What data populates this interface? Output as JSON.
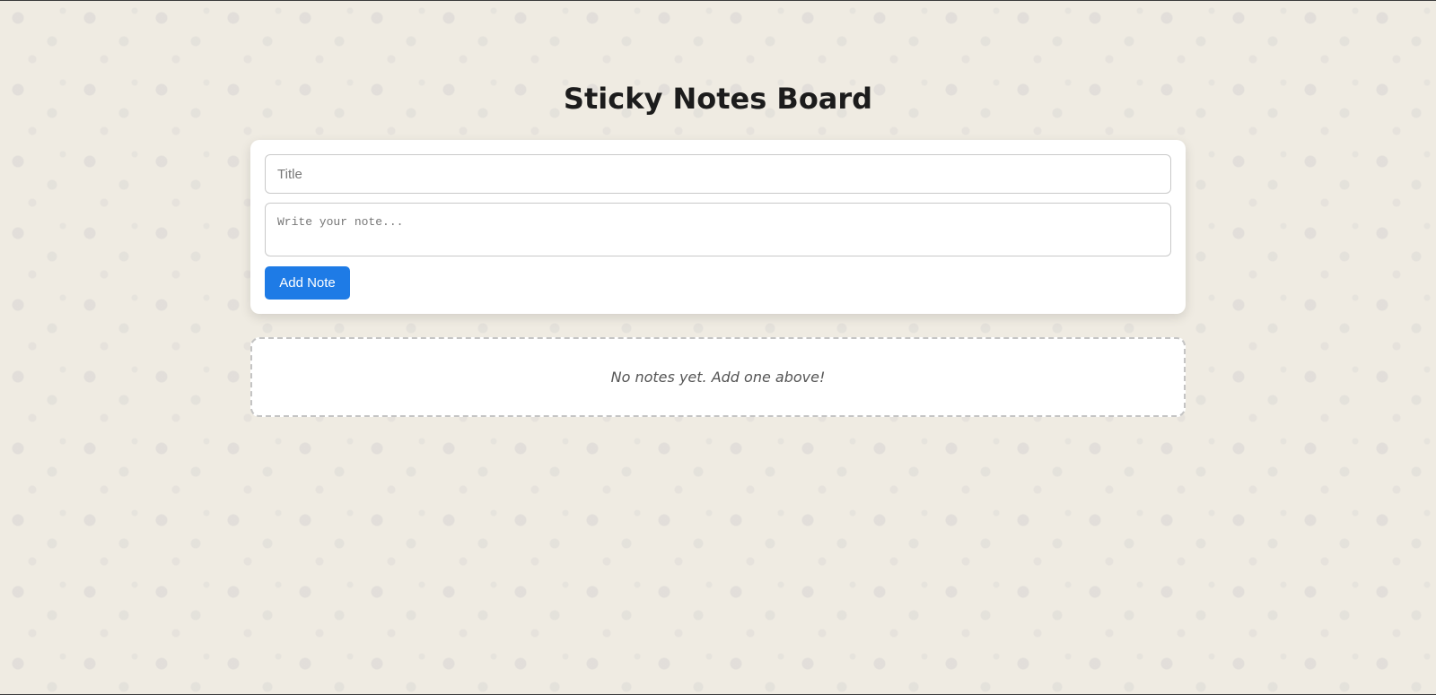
{
  "header": {
    "title": "Sticky Notes Board"
  },
  "form": {
    "title_placeholder": "Title",
    "title_value": "",
    "note_placeholder": "Write your note...",
    "note_value": "",
    "add_button_label": "Add Note"
  },
  "notes": {
    "items": [],
    "empty_message": "No notes yet. Add one above!"
  },
  "colors": {
    "accent": "#1e7be6",
    "background": "#efebe2",
    "card": "#ffffff"
  }
}
